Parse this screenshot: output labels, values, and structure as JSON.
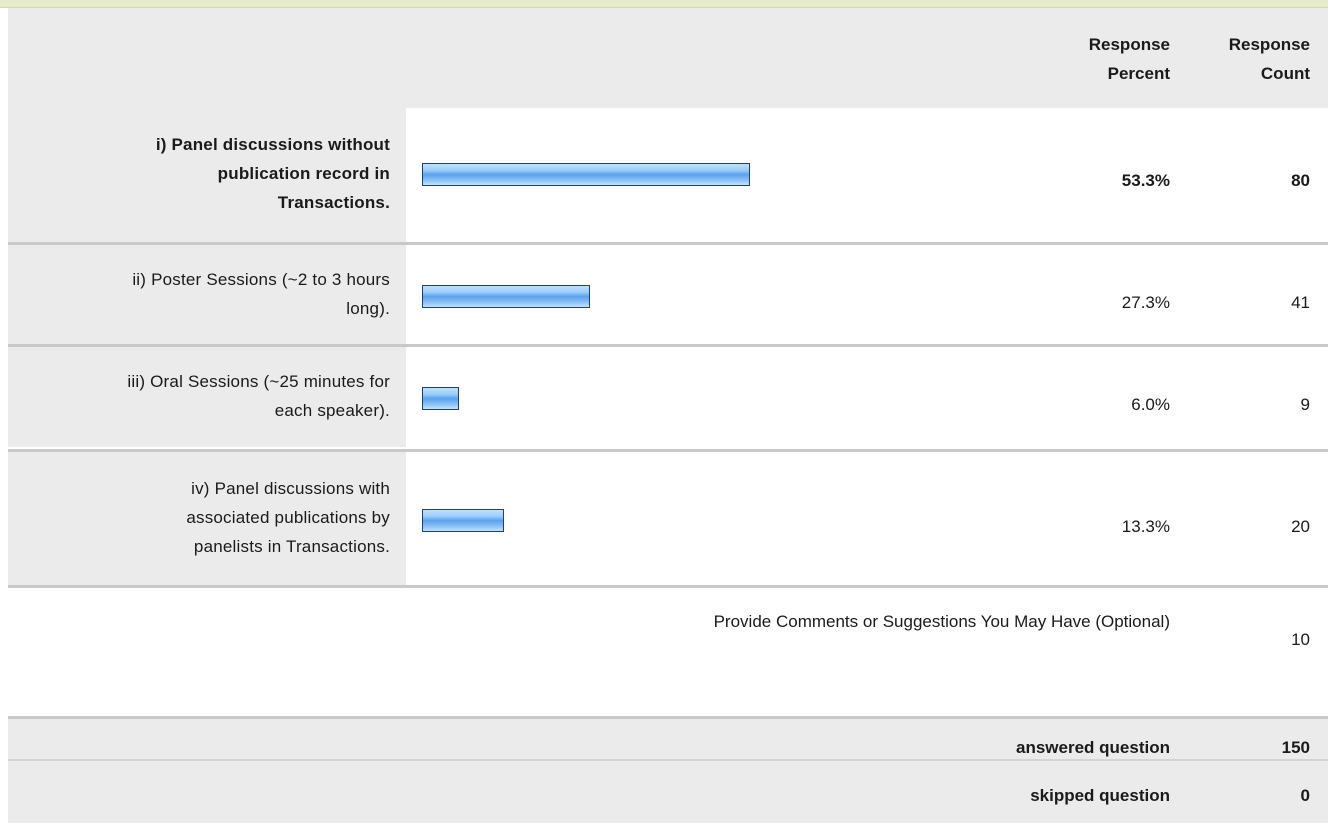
{
  "header": {
    "percent_label_line1": "Response",
    "percent_label_line2": "Percent",
    "count_label_line1": "Response",
    "count_label_line2": "Count"
  },
  "chart_data": {
    "type": "bar",
    "orientation": "horizontal",
    "categories": [
      "i) Panel discussions without publication record in Transactions.",
      "ii) Poster Sessions (~2 to 3 hours long).",
      "iii) Oral Sessions (~25 minutes for each speaker).",
      "iv) Panel discussions with associated publications by panelists in Transactions."
    ],
    "series": [
      {
        "values": [
          53.3,
          27.3,
          6.0,
          13.3
        ]
      }
    ],
    "percent_labels": [
      "53.3%",
      "27.3%",
      "6.0%",
      "13.3%"
    ],
    "counts": [
      "80",
      "41",
      "9",
      "20"
    ],
    "bar_color": "#7fbaf5",
    "bar_border_color": "#1f3f7c",
    "grid": false,
    "legend": "none"
  },
  "rows": [
    {
      "label_lines": [
        "i) Panel discussions without",
        "publication record in",
        "Transactions."
      ],
      "bold": true
    },
    {
      "label_lines": [
        "ii) Poster Sessions (~2 to 3 hours",
        "long)."
      ],
      "bold": false
    },
    {
      "label_lines": [
        "iii) Oral Sessions (~25 minutes for",
        "each speaker)."
      ],
      "bold": false
    },
    {
      "label_lines": [
        "iv) Panel discussions with",
        "associated publications by",
        "panelists in Transactions."
      ],
      "bold": false
    }
  ],
  "comments": {
    "label": "Provide Comments or Suggestions You May Have (Optional)",
    "count": "10"
  },
  "footer": {
    "answered_label": "answered question",
    "answered_value": "150",
    "skipped_label": "skipped question",
    "skipped_value": "0"
  }
}
